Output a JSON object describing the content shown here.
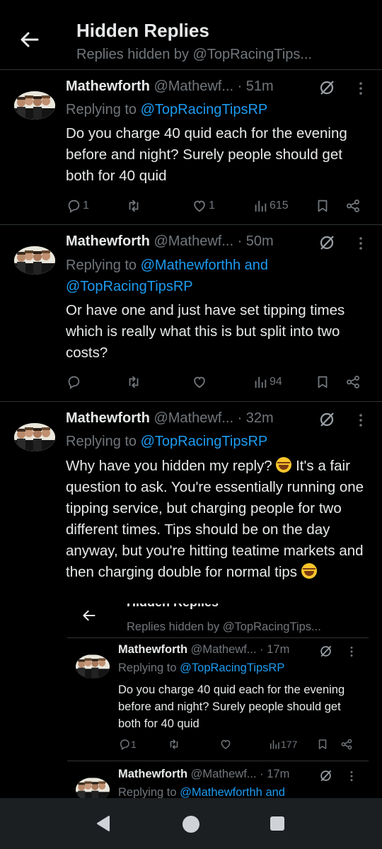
{
  "header": {
    "title": "Hidden Replies",
    "subtitle": "Replies hidden by @TopRacingTips..."
  },
  "tweets": [
    {
      "name": "Mathewforth",
      "handle": "@Mathewf...",
      "time": "· 51m",
      "replying_label": "Replying to ",
      "replying_to": "@TopRacingTipsRP",
      "text": "Do you charge 40 quid each for the evening before and night? Surely people should get both for 40 quid",
      "replies": "1",
      "retweets": "",
      "likes": "1",
      "views": "615"
    },
    {
      "name": "Mathewforth",
      "handle": "@Mathewf...",
      "time": "· 50m",
      "replying_label": "Replying to ",
      "replying_to": "@Mathewforthh and",
      "replying_to_2": "@TopRacingTipsRP",
      "text": "Or have one and just have set tipping times which is really what this is but split into two costs?",
      "replies": "",
      "retweets": "",
      "likes": "",
      "views": "94"
    },
    {
      "name": "Mathewforth",
      "handle": "@Mathewf...",
      "time": "· 32m",
      "replying_label": "Replying to ",
      "replying_to": "@TopRacingTipsRP",
      "text_1": "Why have you hidden my reply? ",
      "text_2": " It's a fair question to ask. You're essentially running one tipping service, but charging people for two different times. Tips should be on the day anyway, but you're hitting teatime markets and then charging double for normal tips "
    }
  ],
  "inner": {
    "title": "Hidden Replies",
    "subtitle": "Replies hidden by @TopRacingTips...",
    "tweets": [
      {
        "name": "Mathewforth",
        "handle": "@Mathewf...",
        "time": "· 17m",
        "replying_label": "Replying to ",
        "replying_to": "@TopRacingTipsRP",
        "text": "Do you charge 40 quid each for the evening before and night? Surely people should get both for 40 quid",
        "replies": "1",
        "views": "177"
      },
      {
        "name": "Mathewforth",
        "handle": "@Mathewf...",
        "time": "· 17m",
        "replying_label": "Replying to ",
        "replying_to": "@Mathewforthh and"
      }
    ]
  },
  "icons": {
    "back": "arrow-left-icon",
    "muted": "hidden-reply-icon",
    "more": "more-vertical-icon",
    "reply": "reply-icon",
    "retweet": "retweet-icon",
    "like": "heart-icon",
    "views": "views-icon",
    "bookmark": "bookmark-icon",
    "share": "share-icon",
    "nav_back": "nav-back-icon",
    "nav_home": "nav-home-icon",
    "nav_recents": "nav-recents-icon"
  },
  "colors": {
    "background": "#000000",
    "text": "#e7e9ea",
    "muted": "#71767b",
    "link": "#1d9bf0",
    "divider": "#2f3336"
  }
}
